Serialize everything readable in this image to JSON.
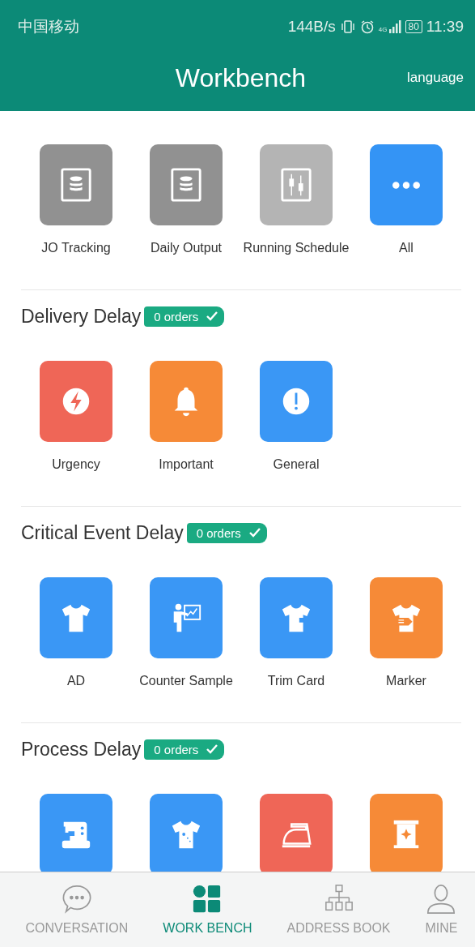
{
  "status_bar": {
    "carrier": "中国移动",
    "speed": "144B/s",
    "network": "4G",
    "battery": "80",
    "time": "11:39"
  },
  "header": {
    "title": "Workbench",
    "action": "language"
  },
  "quick_tiles": [
    {
      "label": "JO Tracking",
      "kind": "database",
      "color": "#919191"
    },
    {
      "label": "Daily Output",
      "kind": "database",
      "color": "#919191"
    },
    {
      "label": "Running Schedule",
      "kind": "sliders",
      "color": "#b4b4b4"
    },
    {
      "label": "All",
      "kind": "more",
      "color": "#3494f5"
    }
  ],
  "sections": [
    {
      "title": "Delivery Delay",
      "badge": "0 orders",
      "tiles": [
        {
          "label": "Urgency",
          "kind": "bolt",
          "color": "#ef6657"
        },
        {
          "label": "Important",
          "kind": "bell",
          "color": "#f68a37"
        },
        {
          "label": "General",
          "kind": "alert",
          "color": "#3a97f5"
        }
      ]
    },
    {
      "title": "Critical Event Delay",
      "badge": "0 orders",
      "tiles": [
        {
          "label": "AD",
          "kind": "shirt-s",
          "color": "#3a97f5"
        },
        {
          "label": "Counter Sample",
          "kind": "presenter",
          "color": "#3a97f5"
        },
        {
          "label": "Trim Card",
          "kind": "pocket-shirt",
          "color": "#3a97f5"
        },
        {
          "label": "Marker",
          "kind": "tag-shirt",
          "color": "#f68a37"
        }
      ]
    },
    {
      "title": "Process Delay",
      "badge": "0 orders",
      "tiles": [
        {
          "kind": "sewing",
          "color": "#3a97f5"
        },
        {
          "kind": "print-shirt",
          "color": "#3a97f5"
        },
        {
          "kind": "iron",
          "color": "#ef6657"
        },
        {
          "kind": "scroll",
          "color": "#f68a37"
        }
      ]
    }
  ],
  "tabs": [
    {
      "label": "CONVERSATION",
      "kind": "chat",
      "selected": false
    },
    {
      "label": "WORK BENCH",
      "kind": "grid",
      "selected": true
    },
    {
      "label": "ADDRESS BOOK",
      "kind": "org",
      "selected": false
    },
    {
      "label": "MINE",
      "kind": "person",
      "selected": false
    }
  ]
}
